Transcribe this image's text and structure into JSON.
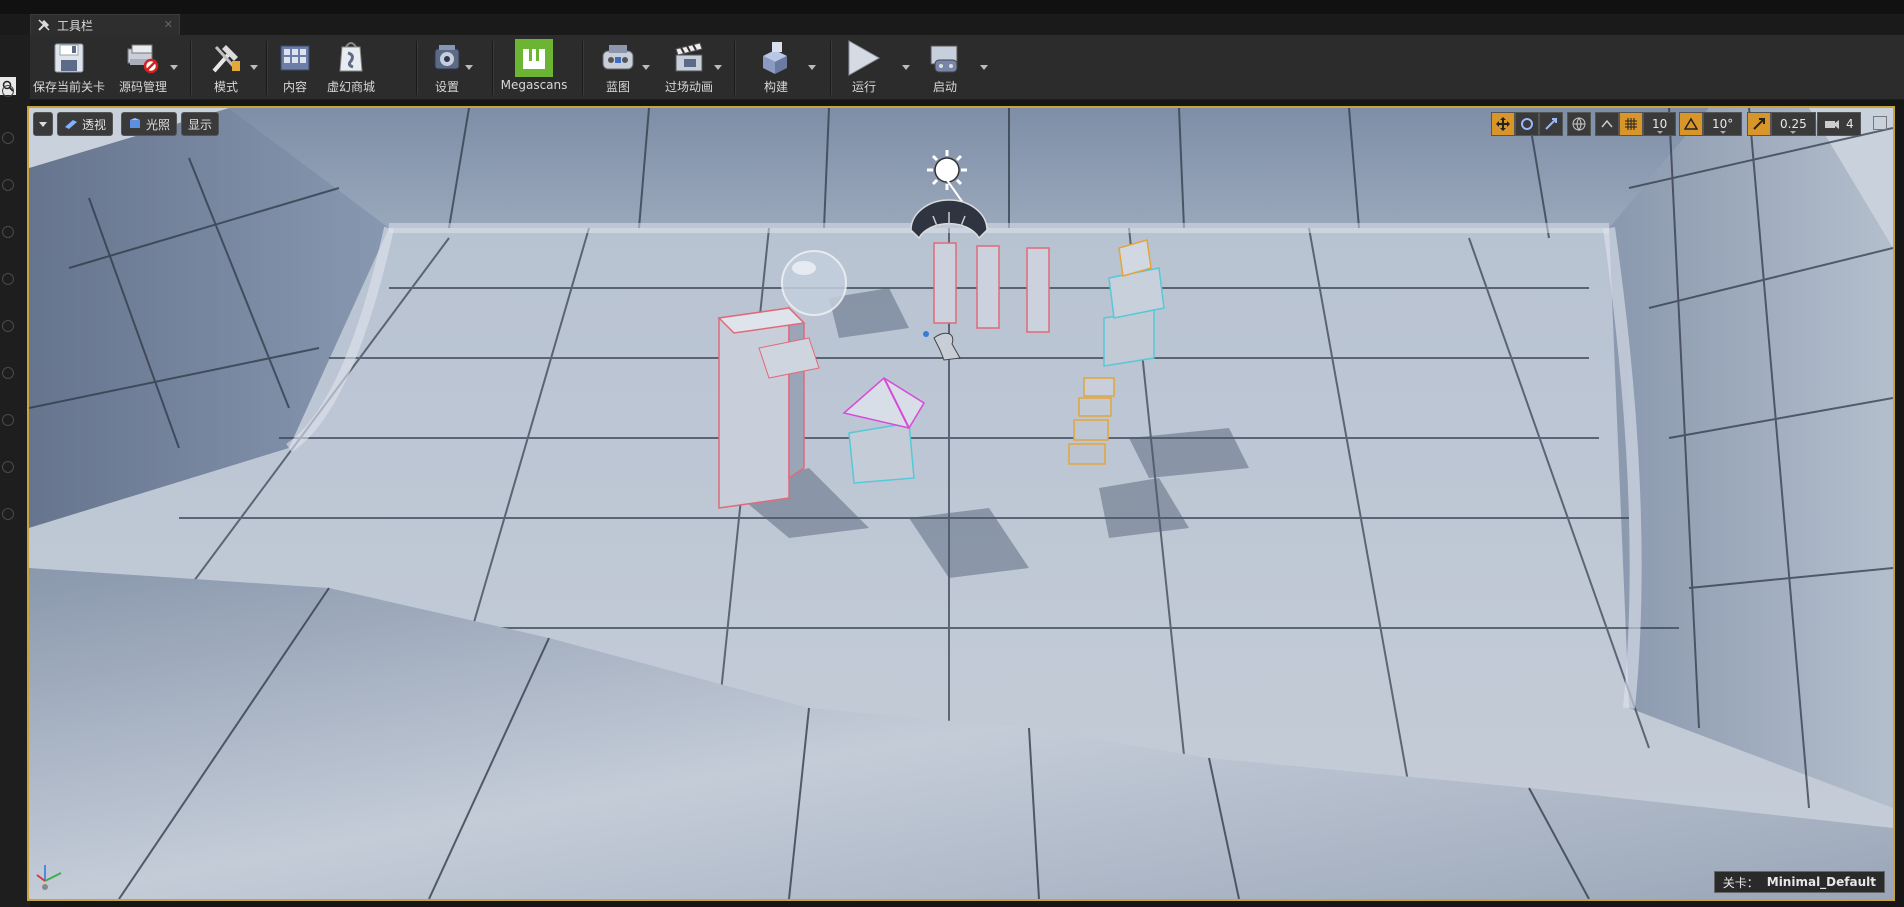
{
  "tab": {
    "title": "工具栏"
  },
  "toolbar": {
    "save_current": "保存当前关卡",
    "source_control": "源码管理",
    "modes": "模式",
    "content": "内容",
    "marketplace": "虚幻商城",
    "settings": "设置",
    "megascans": "Megascans",
    "blueprints": "蓝图",
    "cinematics": "过场动画",
    "build": "构建",
    "play": "运行",
    "launch": "启动"
  },
  "viewport": {
    "perspective": "透视",
    "lit": "光照",
    "show": "显示",
    "grid_snap_value": "10",
    "rotation_snap_value": "10°",
    "scale_snap_value": "0.25",
    "camera_speed_value": "4",
    "level_key": "关卡：",
    "level_name": "Minimal_Default"
  },
  "colors": {
    "accent": "#c9a43a",
    "snap_orange": "#d8962a",
    "toolbar_bg": "#2c2c2c"
  }
}
